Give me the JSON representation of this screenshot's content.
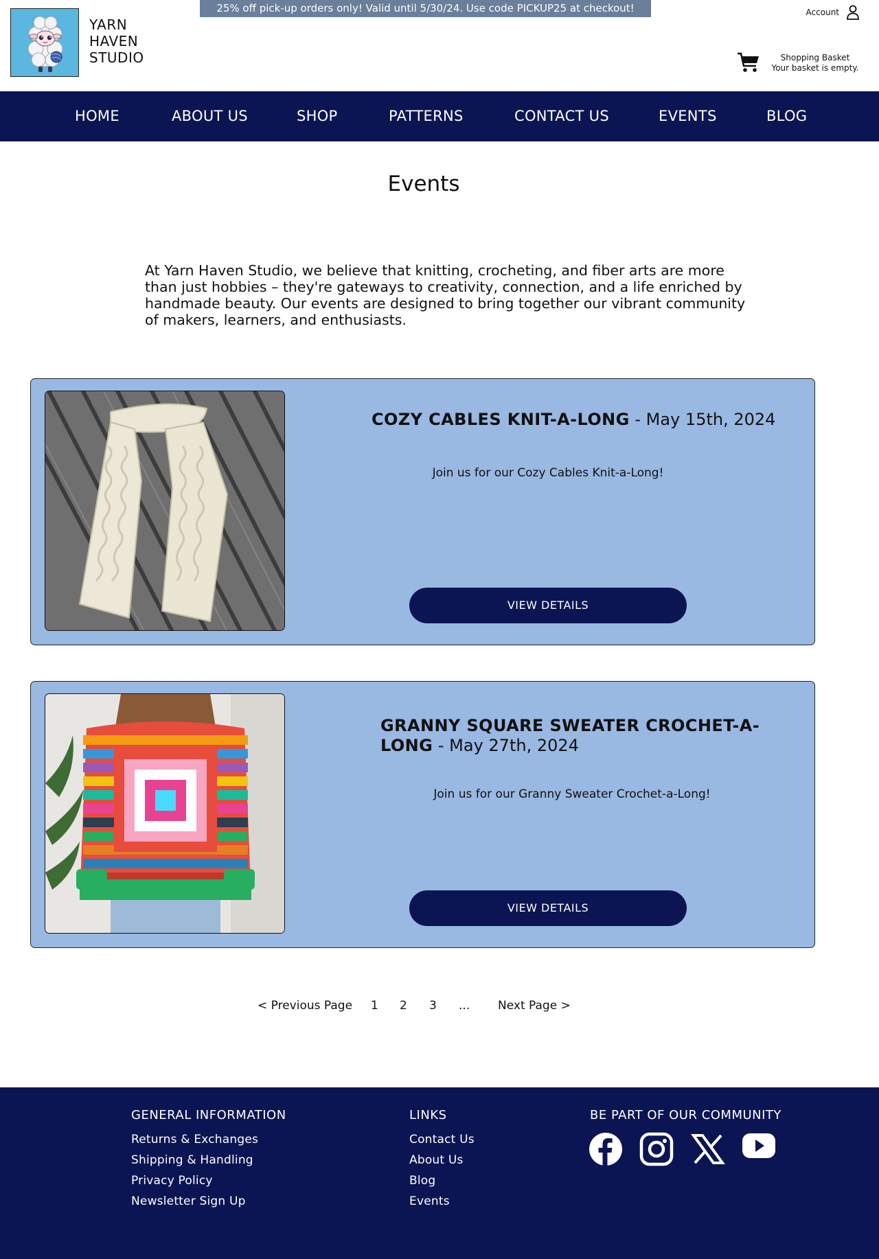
{
  "header": {
    "logo_lines": [
      "YARN",
      "HAVEN",
      "STUDIO"
    ],
    "promo": "25% off pick-up orders only! Valid until 5/30/24. Use code PICKUP25 at checkout!",
    "account_label": "Account",
    "basket_title": "Shopping Basket",
    "basket_status": "Your basket is empty."
  },
  "nav": {
    "items": [
      "HOME",
      "ABOUT US",
      "SHOP",
      "PATTERNS",
      "CONTACT US",
      "EVENTS",
      "BLOG"
    ]
  },
  "page": {
    "title": "Events",
    "intro": "At Yarn Haven Studio, we believe that knitting, crocheting, and fiber arts are more than just hobbies – they're gateways to creativity, connection, and a life enriched by handmade beauty. Our events are designed to bring together our vibrant community of makers, learners, and enthusiasts."
  },
  "events": [
    {
      "name": "COZY CABLES KNIT-A-LONG",
      "date": "- May 15th, 2024",
      "description": "Join us for our Cozy Cables Knit-a-Long!",
      "button": "VIEW DETAILS"
    },
    {
      "name": "GRANNY SQUARE SWEATER CROCHET-A-LONG",
      "date": "- May 27th, 2024",
      "description": "Join us for our Granny Sweater Crochet-a-Long!",
      "button": "VIEW DETAILS"
    }
  ],
  "pagination": {
    "prev": "< Previous Page",
    "pages": [
      "1",
      "2",
      "3"
    ],
    "ellipsis": "...",
    "next": "Next Page >"
  },
  "footer": {
    "general_heading": "GENERAL INFORMATION",
    "general_links": [
      "Returns & Exchanges",
      "Shipping & Handling",
      "Privacy Policy",
      "Newsletter Sign Up"
    ],
    "links_heading": "LINKS",
    "links": [
      "Contact Us",
      "About Us",
      "Blog",
      "Events"
    ],
    "community_heading": "BE PART OF OUR COMMUNITY",
    "social_icons": [
      "facebook-icon",
      "instagram-icon",
      "x-icon",
      "youtube-icon"
    ]
  },
  "colors": {
    "nav_background": "#0c1553",
    "card_background": "#99b8e2",
    "promo_background": "#6a7f9a",
    "logo_background": "#5bb6e0"
  }
}
